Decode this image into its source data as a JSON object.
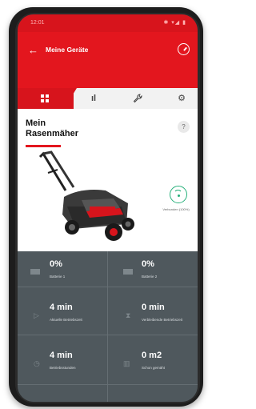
{
  "status_bar": {
    "time": "12:01",
    "icons": "✱ ▾◢ ▮"
  },
  "header": {
    "title": "Meine Geräte",
    "back_glyph": "←"
  },
  "tabs": [
    {
      "name": "overview",
      "glyph": "▦"
    },
    {
      "name": "statistics",
      "glyph": "ıl"
    },
    {
      "name": "maintenance",
      "glyph": "🔧"
    },
    {
      "name": "settings",
      "glyph": "⚙"
    }
  ],
  "device": {
    "title_line1": "Mein",
    "title_line2": "Rasenmäher",
    "help_label": "?",
    "connection": "Verbunden (100%)"
  },
  "stats": [
    {
      "value": "0%",
      "label": "Batterie 1",
      "icon": "battery-icon"
    },
    {
      "value": "0%",
      "label": "Batterie 2",
      "icon": "battery-icon"
    },
    {
      "value": "4 min",
      "label": "Aktuelle Betriebszeit",
      "icon": "play-icon"
    },
    {
      "value": "0 min",
      "label": "Verbleibende Betriebszeit",
      "icon": "hourglass-icon"
    },
    {
      "value": "4 min",
      "label": "Betriebsstunden",
      "icon": "clock-icon"
    },
    {
      "value": "0 m2",
      "label": "Schon gemäht",
      "icon": "lawn-icon"
    }
  ],
  "colors": {
    "brand_red": "#e3161e",
    "panel_gray": "#4f585d",
    "connected_green": "#26b07a"
  }
}
